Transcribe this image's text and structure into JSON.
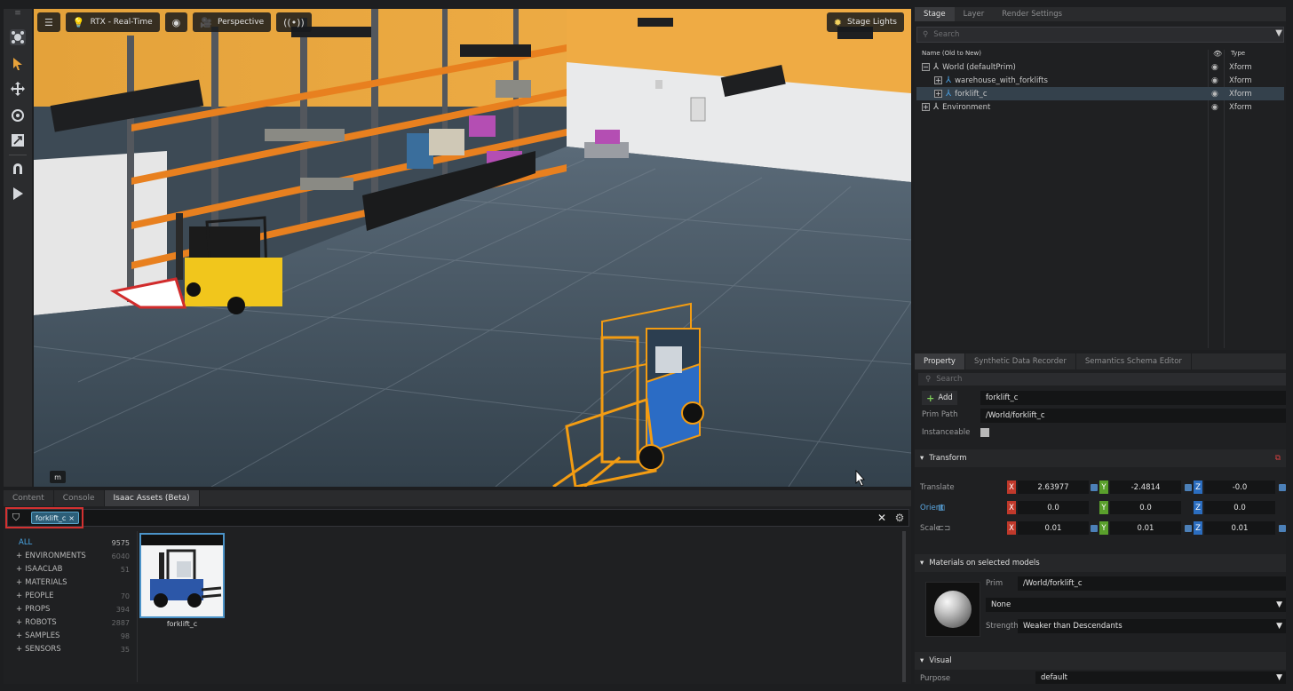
{
  "viewport": {
    "renderer_label": "RTX - Real-Time",
    "camera_label": "Perspective",
    "stage_lights_label": "Stage Lights",
    "unit_label": "m"
  },
  "content_browser": {
    "tabs": [
      "Content",
      "Console",
      "Isaac Assets (Beta)"
    ],
    "active_tab": "Isaac Assets (Beta)",
    "search_chip": "forklift_c",
    "chip_close": "×",
    "clear_icon": "✕",
    "categories": [
      {
        "name": "ALL",
        "count": "9575",
        "prefix": ""
      },
      {
        "name": "ENVIRONMENTS",
        "count": "6040",
        "prefix": "+"
      },
      {
        "name": "ISAACLAB",
        "count": "51",
        "prefix": "+"
      },
      {
        "name": "MATERIALS",
        "count": "",
        "prefix": "+"
      },
      {
        "name": "PEOPLE",
        "count": "70",
        "prefix": "+"
      },
      {
        "name": "PROPS",
        "count": "394",
        "prefix": "+"
      },
      {
        "name": "ROBOTS",
        "count": "2887",
        "prefix": "+"
      },
      {
        "name": "SAMPLES",
        "count": "98",
        "prefix": "+"
      },
      {
        "name": "SENSORS",
        "count": "35",
        "prefix": "+"
      }
    ],
    "result_label": "forklift_c"
  },
  "stage": {
    "tabs": [
      "Stage",
      "Layer",
      "Render Settings"
    ],
    "search_placeholder": "Search",
    "col_name": "Name (Old to New)",
    "col_type": "Type",
    "rows": [
      {
        "name": "World (defaultPrim)",
        "type": "Xform",
        "exp": "−",
        "indent": 0
      },
      {
        "name": "warehouse_with_forklifts",
        "type": "Xform",
        "exp": "+",
        "indent": 1
      },
      {
        "name": "forklift_c",
        "type": "Xform",
        "exp": "+",
        "indent": 1
      },
      {
        "name": "Environment",
        "type": "Xform",
        "exp": "+",
        "indent": 0
      }
    ]
  },
  "property": {
    "tabs": [
      "Property",
      "Synthetic Data Recorder",
      "Semantics Schema Editor"
    ],
    "search_placeholder": "Search",
    "add_label": "Add",
    "prim_name": "forklift_c",
    "prim_path_label": "Prim Path",
    "prim_path": "/World/forklift_c",
    "instanceable_label": "Instanceable",
    "transform_label": "Transform",
    "translate_label": "Translate",
    "orient_label": "Orient",
    "scale_label": "Scale",
    "translate": [
      "2.63977",
      "-2.4814",
      "-0.0"
    ],
    "orient": [
      "0.0",
      "0.0",
      "0.0"
    ],
    "scale": [
      "0.01",
      "0.01",
      "0.01"
    ],
    "materials_label": "Materials on selected models",
    "mat_prim_label": "Prim",
    "mat_prim": "/World/forklift_c",
    "mat_material": "None",
    "strength_label": "Strength",
    "strength_value": "Weaker than Descendants",
    "visual_label": "Visual",
    "purpose_label": "Purpose",
    "purpose_value": "default"
  }
}
